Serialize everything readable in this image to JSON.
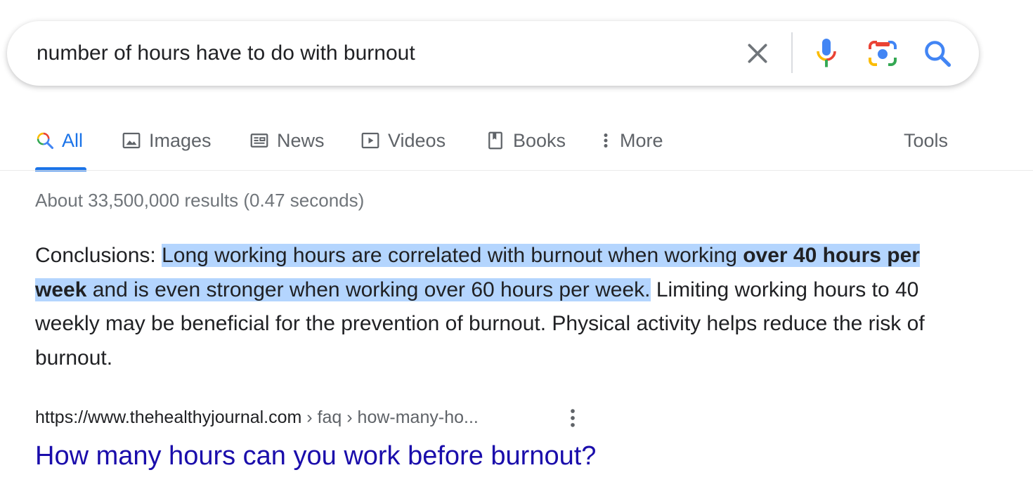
{
  "search": {
    "query": "number of hours have to do with burnout"
  },
  "tabs": [
    {
      "label": "All",
      "icon": "search-icon",
      "active": true
    },
    {
      "label": "Images",
      "icon": "image-icon"
    },
    {
      "label": "News",
      "icon": "news-icon"
    },
    {
      "label": "Videos",
      "icon": "video-icon"
    },
    {
      "label": "Books",
      "icon": "book-icon"
    },
    {
      "label": "More",
      "icon": "more-vert-icon"
    }
  ],
  "tools_label": "Tools",
  "result_stats": "About 33,500,000 results (0.47 seconds)",
  "snippet": {
    "prefix": "Conclusions: ",
    "hl_1": "Long working hours are correlated with burnout when working ",
    "hl_bold": "over 40 hours per week",
    "hl_2": " and is even stronger when working over 60 hours per week.",
    "rest": " Limiting working hours to 40 weekly may be beneficial for the prevention of burnout. Physical activity helps reduce the risk of burnout."
  },
  "result": {
    "site": "https://www.thehealthyjournal.com",
    "path": " › faq › how-many-ho...",
    "title": "How many hours can you work before burnout?"
  },
  "colors": {
    "link": "#1a0dab",
    "accent": "#1a73e8",
    "highlight": "#b4d5fe"
  }
}
